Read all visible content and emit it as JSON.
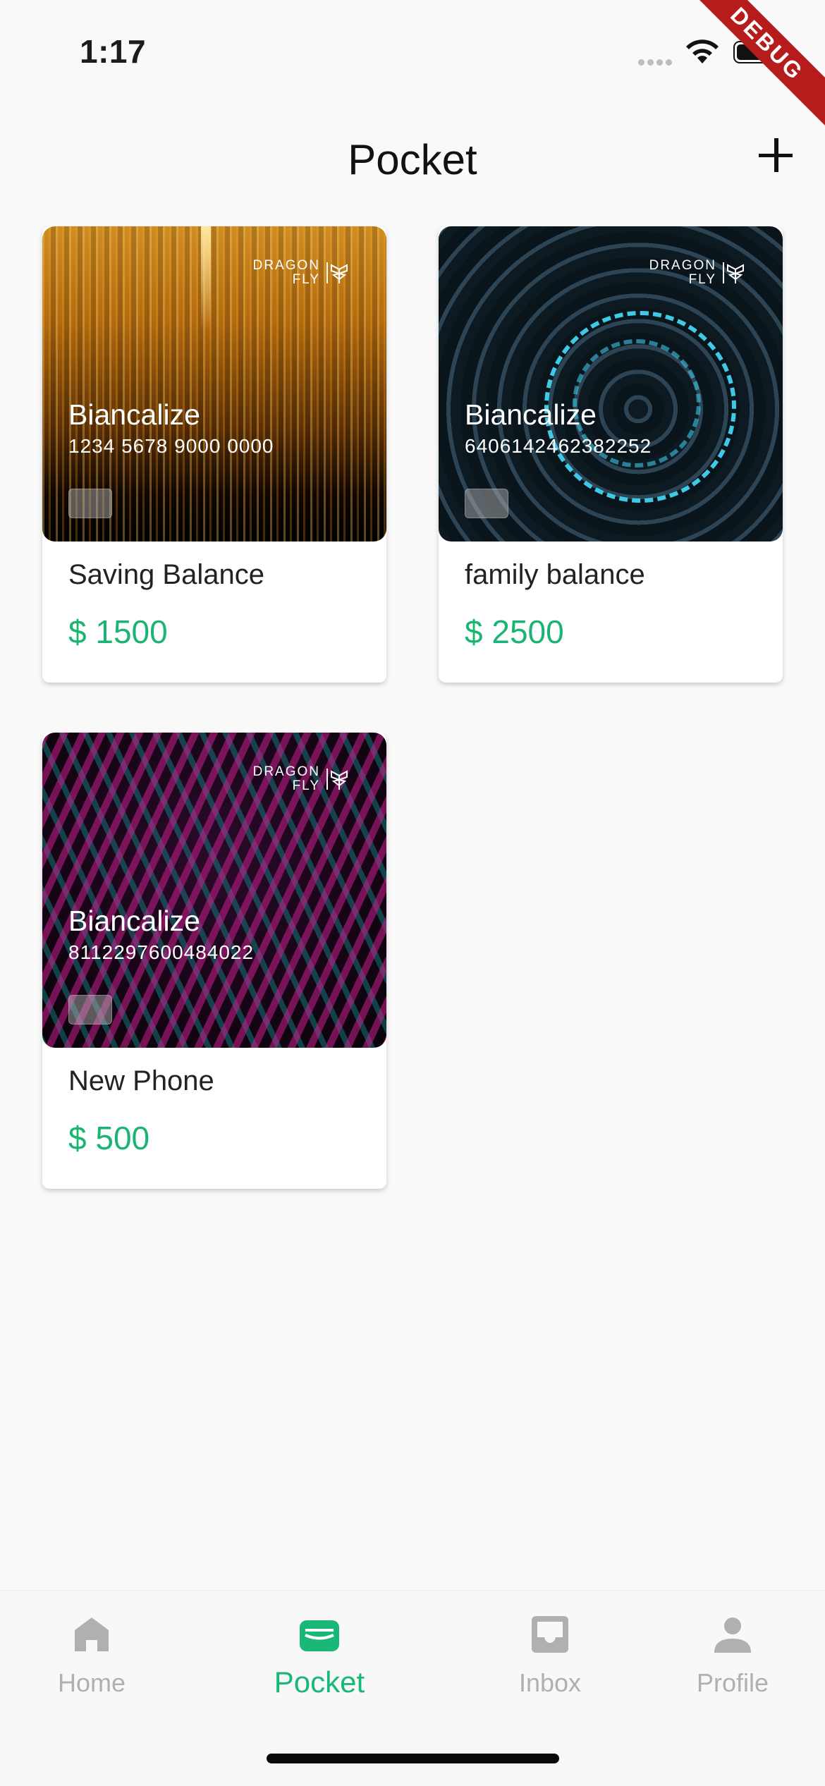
{
  "status_bar": {
    "time": "1:17",
    "debug_banner": "DEBUG"
  },
  "header": {
    "title": "Pocket",
    "add_icon": "plus-icon"
  },
  "pockets": [
    {
      "holder": "Biancalize",
      "number": "1234 5678 9000 0000",
      "name": "Saving Balance",
      "amount": "$ 1500",
      "brand_line1": "DRAGON",
      "brand_line2": "FLY"
    },
    {
      "holder": "Biancalize",
      "number": "6406142462382252",
      "name": "family balance",
      "amount": "$ 2500",
      "brand_line1": "DRAGON",
      "brand_line2": "FLY"
    },
    {
      "holder": "Biancalize",
      "number": "8112297600484022",
      "name": "New Phone",
      "amount": "$ 500",
      "brand_line1": "DRAGON",
      "brand_line2": "FLY"
    }
  ],
  "bottom_nav": {
    "items": [
      {
        "label": "Home",
        "icon": "home-icon"
      },
      {
        "label": "Pocket",
        "icon": "wallet-icon",
        "active": true
      },
      {
        "label": "Inbox",
        "icon": "inbox-icon"
      },
      {
        "label": "Profile",
        "icon": "person-icon"
      }
    ]
  },
  "colors": {
    "accent": "#19b877",
    "amount": "#1bb573",
    "inactive_nav": "#b0b0b0",
    "debug_ribbon": "#b71c1c"
  }
}
